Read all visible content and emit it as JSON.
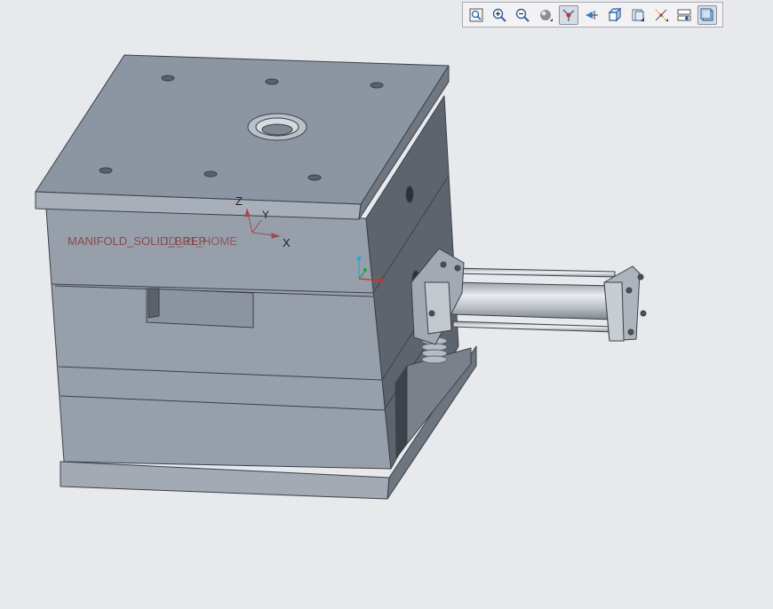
{
  "viewport": {
    "background": "#e8e9ed",
    "mold_color": "#8e97a3",
    "label_color": "#8a3b3b"
  },
  "model_labels": {
    "overlap_text": "MANIFOLD_SOLID_BREP",
    "overlap_text_2": "ID_31_HOME"
  },
  "csys": {
    "z": "Z",
    "y": "Y",
    "x": "X"
  },
  "toolbar": {
    "buttons": [
      {
        "name": "zoom-fit-icon"
      },
      {
        "name": "zoom-in-icon"
      },
      {
        "name": "zoom-out-icon"
      },
      {
        "name": "shading-icon"
      },
      {
        "name": "datum-display-icon"
      },
      {
        "name": "spin-center-icon"
      },
      {
        "name": "view-orient-icon"
      },
      {
        "name": "saved-views-icon"
      },
      {
        "name": "datum-points-icon"
      },
      {
        "name": "layers-icon"
      },
      {
        "name": "render-style-icon"
      }
    ]
  }
}
